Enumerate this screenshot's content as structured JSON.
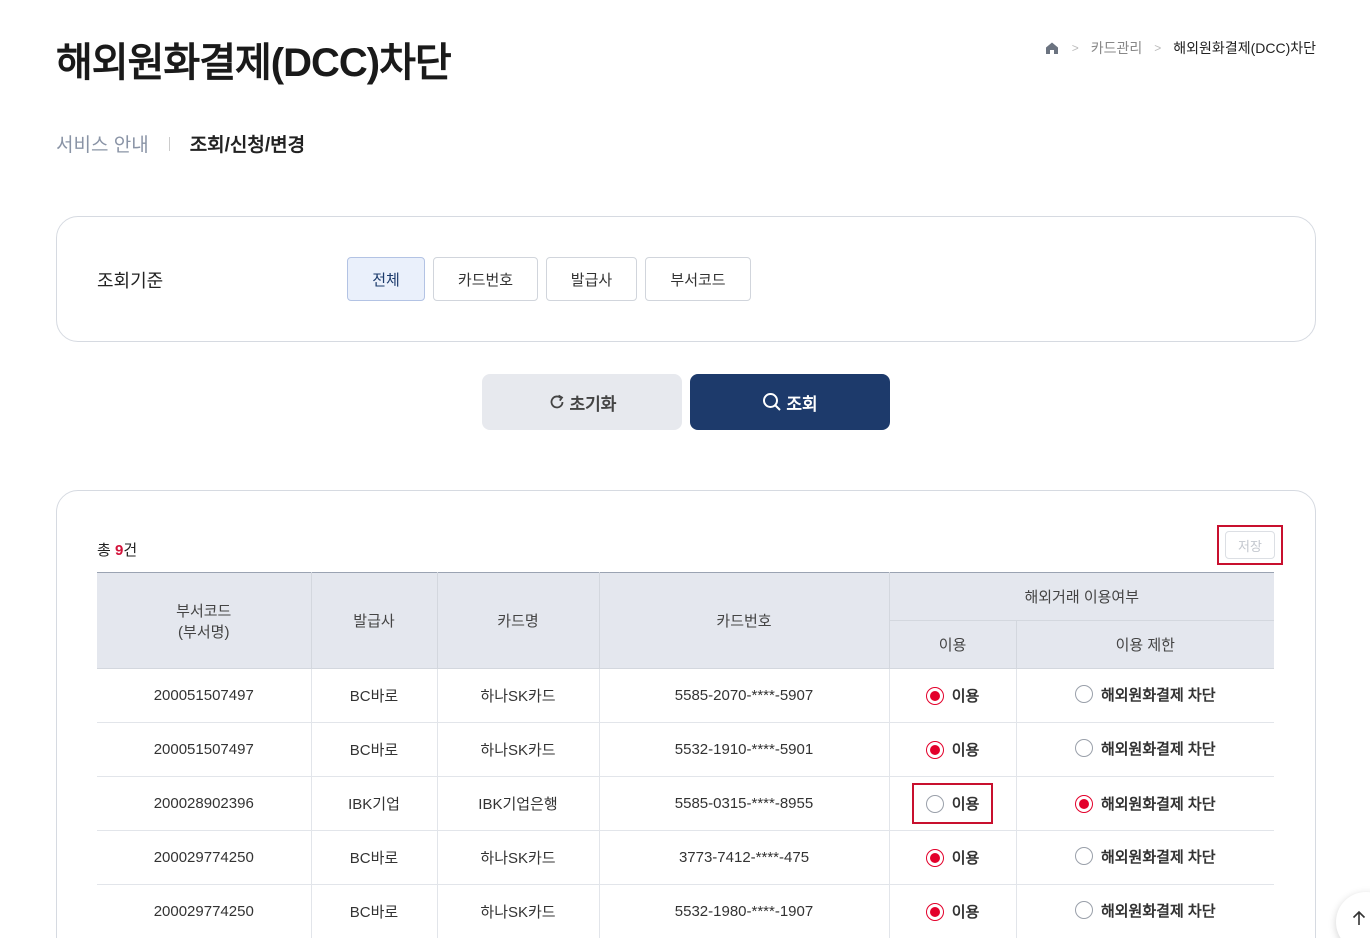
{
  "page_title": "해외원화결제(DCC)차단",
  "breadcrumb": {
    "level1": "카드관리",
    "current": "해외원화결제(DCC)차단"
  },
  "subtabs": [
    {
      "label": "서비스 안내"
    },
    {
      "label": "조회/신청/변경"
    }
  ],
  "filter": {
    "label": "조회기준",
    "options": [
      {
        "label": "전체"
      },
      {
        "label": "카드번호"
      },
      {
        "label": "발급사"
      },
      {
        "label": "부서코드"
      }
    ],
    "selected": "전체"
  },
  "buttons": {
    "reset": "초기화",
    "search": "조회"
  },
  "result": {
    "total_prefix": "총 ",
    "total_count": "9",
    "total_suffix": "건",
    "save_label": "저장",
    "headers": {
      "dept_line1": "부서코드",
      "dept_line2": "(부서명)",
      "issuer": "발급사",
      "card_name": "카드명",
      "card_number": "카드번호",
      "overseas_group": "해외거래 이용여부",
      "use": "이용",
      "restrict": "이용 제한"
    },
    "option_use_label": "이용",
    "option_block_label": "해외원화결제 차단",
    "rows": [
      {
        "dept_code": "200051507497",
        "issuer": "BC바로",
        "card_name": "하나SK카드",
        "card_number": "5585-2070-****-5907",
        "selected": "use"
      },
      {
        "dept_code": "200051507497",
        "issuer": "BC바로",
        "card_name": "하나SK카드",
        "card_number": "5532-1910-****-5901",
        "selected": "use"
      },
      {
        "dept_code": "200028902396",
        "issuer": "IBK기업",
        "card_name": "IBK기업은행",
        "card_number": "5585-0315-****-8955",
        "selected": "block"
      },
      {
        "dept_code": "200029774250",
        "issuer": "BC바로",
        "card_name": "하나SK카드",
        "card_number": "3773-7412-****-475",
        "selected": "use"
      },
      {
        "dept_code": "200029774250",
        "issuer": "BC바로",
        "card_name": "하나SK카드",
        "card_number": "5532-1980-****-1907",
        "selected": "use"
      }
    ]
  },
  "colors": {
    "primary": "#1d3a6b",
    "accent_red": "#e3002b",
    "highlight_box": "#c8102e"
  }
}
